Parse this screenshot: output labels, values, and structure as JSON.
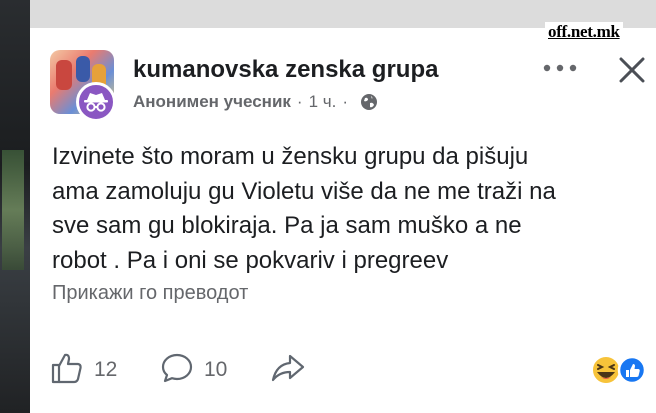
{
  "watermark": "off.net.mk",
  "post": {
    "group_name": "kumanovska zenska grupa",
    "author": "Анонимен учесник",
    "separator": "·",
    "time": "1 ч.",
    "text_lines": [
      "Izvinete što moram u žensku grupu da pišuju",
      "ama zamoluju gu Violetu više da ne me traži na",
      "sve sam gu blokiraja. Pa ja sam muško a ne",
      "robot . Pa i oni se pokvariv i pregreev"
    ],
    "translate_link": "Прикажи го преводот"
  },
  "actions": {
    "like_count": "12",
    "comment_count": "10"
  },
  "icons": {
    "avatar_badge": "anonymous-icon",
    "privacy": "globe-icon",
    "more": "more-options-icon",
    "close": "close-icon",
    "like": "thumbs-up-icon",
    "comment": "comment-icon",
    "share": "share-icon",
    "reactions": [
      "haha-reaction-icon",
      "like-reaction-icon"
    ]
  },
  "colors": {
    "card_bg": "#ffffff",
    "text_primary": "#1c1e21",
    "text_secondary": "#65676b",
    "anon_badge": "#8a57c2",
    "like_blue": "#1877f2",
    "haha_yellow": "#f7c33a"
  }
}
